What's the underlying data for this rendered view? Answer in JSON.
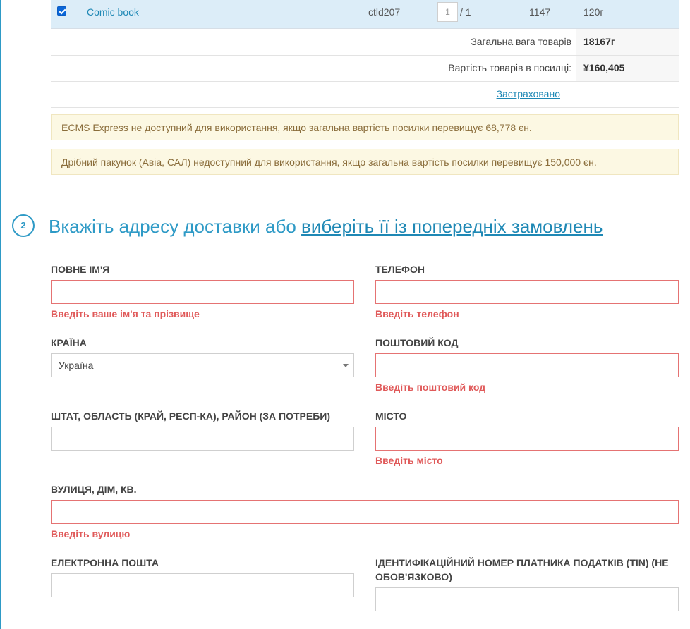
{
  "cart": {
    "selected_row": {
      "product": "Comic book",
      "code": "ctld207",
      "quantity": "1",
      "quantity_total": "/ 1",
      "id_number": "1147",
      "weight": "120г"
    },
    "total_weight": {
      "label": "Загальна вага товарів",
      "value": "18167г"
    },
    "goods_cost": {
      "label": "Вартість товарів в посилці:",
      "value": "¥160,405"
    },
    "insured_link": "Застраховано"
  },
  "notices": [
    "ECMS Express не доступний для використання, якщо загальна вартість посилки перевищує 68,778 єн.",
    "Дрібний пакунок (Авіа, САЛ) недоступний для використання, якщо загальна вартість посилки перевищує 150,000 єн."
  ],
  "address_section": {
    "step_number": "2",
    "heading_text": "Вкажіть адресу доставки або ",
    "heading_link": "виберіть її із попередніх замовлень",
    "fields": {
      "full_name": {
        "label": "ПОВНЕ ІМ'Я",
        "value": "",
        "error": "Введіть ваше ім'я та прізвище"
      },
      "phone": {
        "label": "ТЕЛЕФОН",
        "value": "",
        "error": "Введіть телефон"
      },
      "country": {
        "label": "КРАЇНА",
        "value": "Україна"
      },
      "postal_code": {
        "label": "ПОШТОВИЙ КОД",
        "value": "",
        "error": "Введіть поштовий код"
      },
      "state": {
        "label": "ШТАТ, ОБЛАСТЬ (КРАЙ, РЕСП-КА), РАЙОН (ЗА ПОТРЕБИ)",
        "value": ""
      },
      "city": {
        "label": "МІСТО",
        "value": "",
        "error": "Введіть місто"
      },
      "street": {
        "label": "ВУЛИЦЯ, ДІМ, КВ.",
        "value": "",
        "error": "Введіть вулицю"
      },
      "email": {
        "label": "ЕЛЕКТРОННА ПОШТА",
        "value": ""
      },
      "tin": {
        "label": "ІДЕНТИФІКАЦІЙНИЙ НОМЕР ПЛАТНИКА ПОДАТКІВ (TIN) (НЕ ОБОВ'ЯЗКОВО)",
        "value": ""
      }
    }
  },
  "colors": {
    "accent": "#2e9ac6",
    "link": "#1e88b5",
    "error": "#e05a5a",
    "notice_bg": "#fcf8e3",
    "selected_row_bg": "#dcedf8"
  }
}
